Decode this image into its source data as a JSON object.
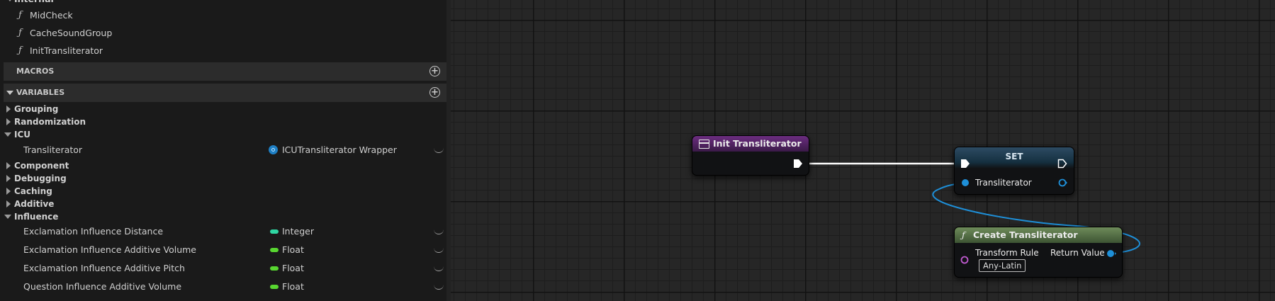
{
  "sidebar": {
    "internal_header": "Internal",
    "functions": [
      {
        "label": "MidCheck",
        "icon": "function-icon"
      },
      {
        "label": "CacheSoundGroup",
        "icon": "function-icon"
      },
      {
        "label": "InitTransliterator",
        "icon": "function-icon"
      }
    ],
    "macros_label": "MACROS",
    "variables_label": "VARIABLES",
    "categories": {
      "grouping": "Grouping",
      "randomization": "Randomization",
      "icu": "ICU",
      "component": "Component",
      "debugging": "Debugging",
      "caching": "Caching",
      "additive": "Additive",
      "influence": "Influence"
    },
    "icu_vars": [
      {
        "name": "Transliterator",
        "type": "ICUTransliterator Wrapper",
        "color": "#1e7fc4"
      }
    ],
    "influence_vars": [
      {
        "name": "Exclamation Influence Distance",
        "type": "Integer",
        "color": "#2fd6a3"
      },
      {
        "name": "Exclamation Influence Additive Volume",
        "type": "Float",
        "color": "#58d630"
      },
      {
        "name": "Exclamation Influence Additive Pitch",
        "type": "Float",
        "color": "#58d630"
      },
      {
        "name": "Question Influence Additive Volume",
        "type": "Float",
        "color": "#58d630"
      }
    ]
  },
  "graph": {
    "init_node": {
      "title": "Init Transliterator",
      "header_color": "#6c2d80"
    },
    "set_node": {
      "title": "SET",
      "input_label": "Transliterator"
    },
    "create_node": {
      "title": "Create Transliterator",
      "input_label": "Transform Rule",
      "input_value": "Any-Latin",
      "output_label": "Return Value",
      "header_color": "#6e8b5a"
    },
    "exec_wire_color": "#ffffff",
    "object_wire_color": "#1e8fd8"
  }
}
